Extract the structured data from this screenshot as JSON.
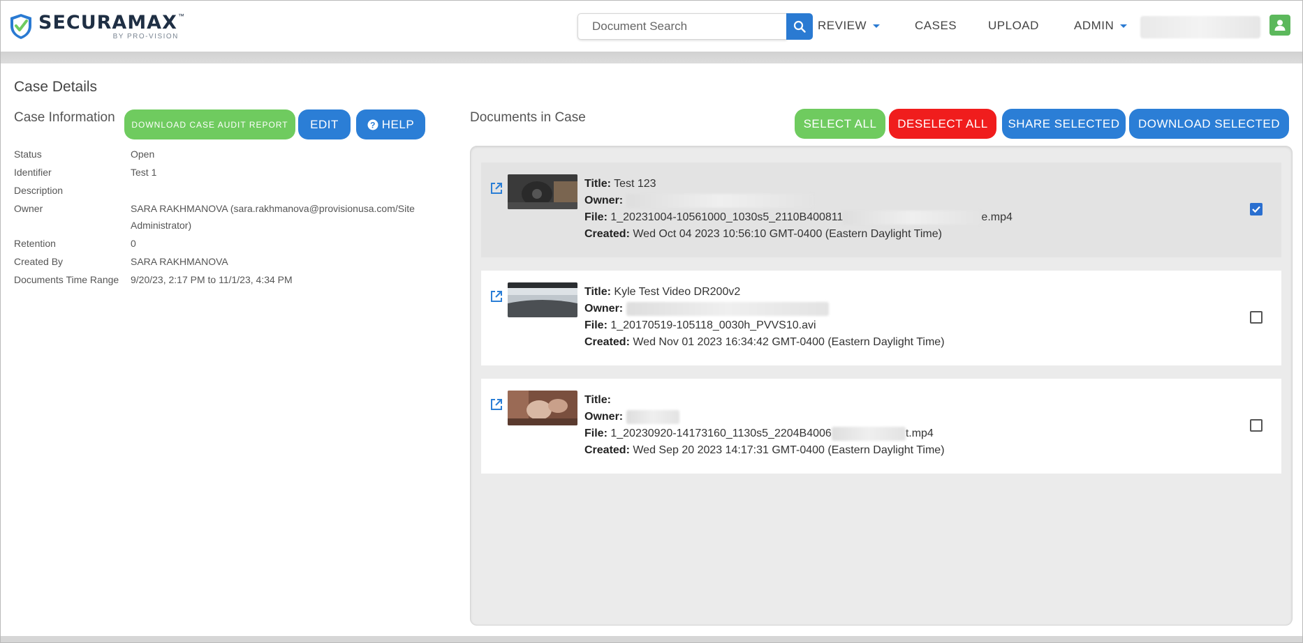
{
  "header": {
    "logo_main": "SECURAMAX",
    "logo_tm": "™",
    "logo_sub": "BY PRO-VISION",
    "search": {
      "placeholder": "Document Search"
    },
    "nav": {
      "review": "REVIEW",
      "cases": "CASES",
      "upload": "UPLOAD",
      "admin": "ADMIN"
    }
  },
  "page": {
    "title": "Case Details"
  },
  "case_info": {
    "title": "Case Information",
    "buttons": {
      "audit": "DOWNLOAD CASE AUDIT REPORT",
      "edit": "EDIT",
      "help": "HELP"
    },
    "fields": [
      {
        "label": "Status",
        "value": "Open"
      },
      {
        "label": "Identifier",
        "value": "Test 1"
      },
      {
        "label": "Description",
        "value": ""
      },
      {
        "label": "Owner",
        "value": "SARA RAKHMANOVA (sara.rakhmanova@provisionusa.com/Site Administrator)"
      },
      {
        "label": "Retention",
        "value": "0"
      },
      {
        "label": "Created By",
        "value": "SARA RAKHMANOVA"
      },
      {
        "label": "Documents Time Range",
        "value": "9/20/23, 2:17 PM to 11/1/23, 4:34 PM"
      }
    ]
  },
  "documents": {
    "title": "Documents in Case",
    "buttons": {
      "select_all": "SELECT ALL",
      "deselect_all": "DESELECT ALL",
      "share": "SHARE SELECTED",
      "download": "DOWNLOAD SELECTED"
    },
    "labels": {
      "title": "Title:",
      "owner": "Owner:",
      "file": "File:",
      "created": "Created:"
    },
    "items": [
      {
        "title": "Test 123",
        "file_start": "1_20231004-10561000_1030s5_2110B400811",
        "file_end": "e.mp4",
        "created": "Wed Oct 04 2023 10:56:10 GMT-0400 (Eastern Daylight Time)",
        "selected": true
      },
      {
        "title": "Kyle Test Video DR200v2",
        "file_start": "1_20170519-105118_0030h_PVVS10.avi",
        "file_end": "",
        "created": "Wed Nov 01 2023 16:34:42 GMT-0400 (Eastern Daylight Time)",
        "selected": false
      },
      {
        "title": "",
        "file_start": "1_20230920-14173160_1130s5_2204B4006",
        "file_end": "t.mp4",
        "created": "Wed Sep 20 2023 14:17:31 GMT-0400 (Eastern Daylight Time)",
        "selected": false
      }
    ]
  },
  "colors": {
    "accent_blue": "#2b7ed6",
    "green": "#6fcb5f",
    "red": "#f01d1d"
  }
}
